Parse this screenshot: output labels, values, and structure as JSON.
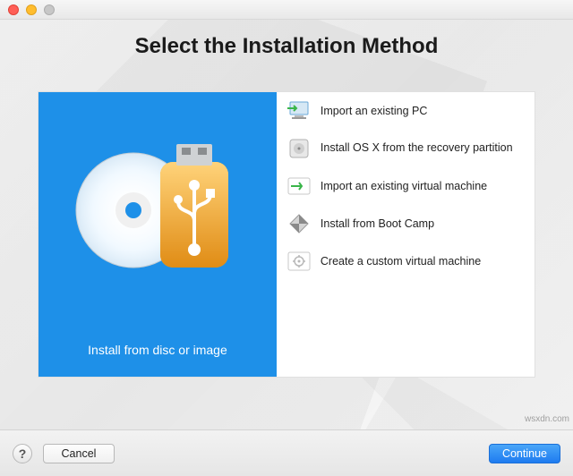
{
  "window": {
    "title_visible": false
  },
  "header": {
    "title": "Select the Installation Method"
  },
  "colors": {
    "accent_blue": "#1e90e8",
    "button_primary": "#2f86f3"
  },
  "left_pane": {
    "caption": "Install from disc or image",
    "icon": "disc-and-usb"
  },
  "options": [
    {
      "icon": "import-pc-icon",
      "label": "Import an existing PC"
    },
    {
      "icon": "hdd-recovery-icon",
      "label": "Install OS X from the recovery partition"
    },
    {
      "icon": "import-vm-icon",
      "label": "Import an existing virtual machine"
    },
    {
      "icon": "bootcamp-icon",
      "label": "Install from Boot Camp"
    },
    {
      "icon": "custom-vm-icon",
      "label": "Create a custom virtual machine"
    }
  ],
  "footer": {
    "help_tooltip": "Help",
    "cancel": "Cancel",
    "continue": "Continue"
  },
  "watermark": "wsxdn.com"
}
